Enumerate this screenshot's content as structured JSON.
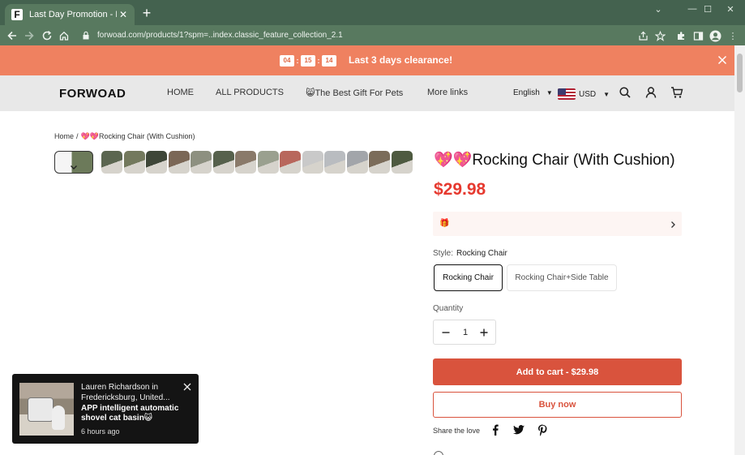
{
  "browser": {
    "tab_title": "Last Day Promotion - Rocking Ch",
    "favicon_letter": "F",
    "url": "forwoad.com/products/1?spm=..index.classic_feature_collection_2.1"
  },
  "promo": {
    "timer": [
      "04",
      "15",
      "14"
    ],
    "separator": ":",
    "text": "Last 3 days clearance!"
  },
  "header": {
    "logo": "FORWOAD",
    "nav": [
      "HOME",
      "ALL PRODUCTS",
      "😸The Best Gift For Pets",
      "More links"
    ],
    "language": "English",
    "currency": "USD"
  },
  "breadcrumb": {
    "home": "Home",
    "separator": "/",
    "current": "💖💖Rocking Chair (With Cushion)"
  },
  "product": {
    "title": "💖💖Rocking Chair (With Cushion)",
    "price": "$29.98",
    "coupon_icon": "🎁",
    "style_label": "Style:",
    "style_value": "Rocking Chair",
    "options": [
      "Rocking Chair",
      "Rocking Chair+Side Table"
    ],
    "selected_option": "Rocking Chair",
    "quantity_label": "Quantity",
    "quantity": "1",
    "add_to_cart": "Add to cart - $29.98",
    "buy_now": "Buy now",
    "share_label": "Share the love"
  },
  "gallery": {
    "thumb_colors": [
      "#5b6650",
      "#73795d",
      "#3e4638",
      "#7b6756",
      "#8d9080",
      "#56614c",
      "#8a7a6a",
      "#9aa08f",
      "#b8675c",
      "#c9c9c9",
      "#b9bcc0",
      "#a2a5aa",
      "#7b6c5a",
      "#4e5a40"
    ]
  },
  "notification": {
    "who": "Lauren Richardson in Fredericksburg, United...",
    "product": "APP intelligent automatic shovel cat basin😺",
    "time_ago": "6 hours ago"
  },
  "colors": {
    "promo_bar": "#ef8160",
    "price": "#e6392f",
    "cta": "#d9533d",
    "chrome": "#58795f"
  }
}
